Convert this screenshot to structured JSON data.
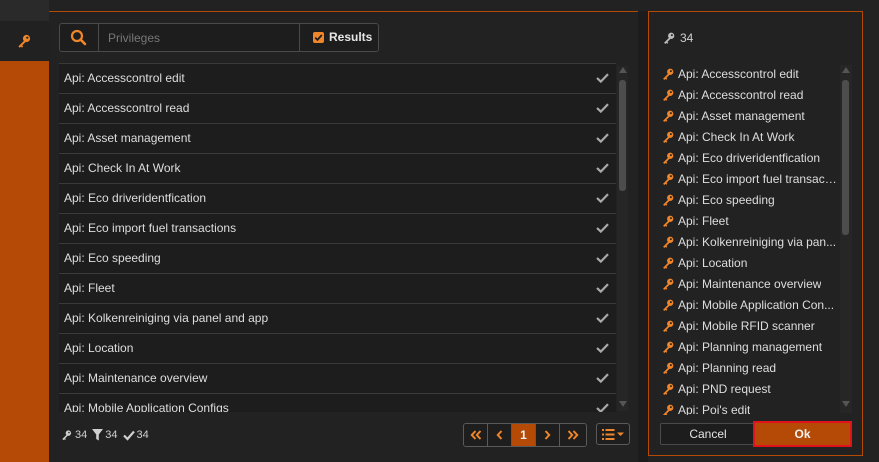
{
  "colors": {
    "accent": "#b54a06",
    "key_icon": "#f0862a",
    "background": "#222222",
    "highlight": "#e2121c"
  },
  "sidebar": {
    "tab_icon": "key-icon"
  },
  "search": {
    "placeholder": "Privileges",
    "value": "",
    "icon": "search-icon"
  },
  "results_toggle": {
    "label": "Results",
    "checked": true
  },
  "privileges": [
    "Api: Accesscontrol edit",
    "Api: Accesscontrol read",
    "Api: Asset management",
    "Api: Check In At Work",
    "Api: Eco driveridentfication",
    "Api: Eco import fuel transactions",
    "Api: Eco speeding",
    "Api: Fleet",
    "Api: Kolkenreiniging via panel and app",
    "Api: Location",
    "Api: Maintenance overview",
    "Api: Mobile Application Configs"
  ],
  "stats": {
    "total": "34",
    "filtered": "34",
    "selected": "34"
  },
  "pagination": {
    "current_page": "1"
  },
  "selected_panel": {
    "count": "34",
    "items": [
      "Api: Accesscontrol edit",
      "Api: Accesscontrol read",
      "Api: Asset management",
      "Api: Check In At Work",
      "Api: Eco driveridentfication",
      "Api: Eco import fuel transact...",
      "Api: Eco speeding",
      "Api: Fleet",
      "Api: Kolkenreiniging via pan...",
      "Api: Location",
      "Api: Maintenance overview",
      "Api: Mobile Application Con...",
      "Api: Mobile RFID scanner",
      "Api: Planning management",
      "Api: Planning read",
      "Api: PND request",
      "Api: Poi's edit"
    ]
  },
  "buttons": {
    "cancel": "Cancel",
    "ok": "Ok"
  }
}
